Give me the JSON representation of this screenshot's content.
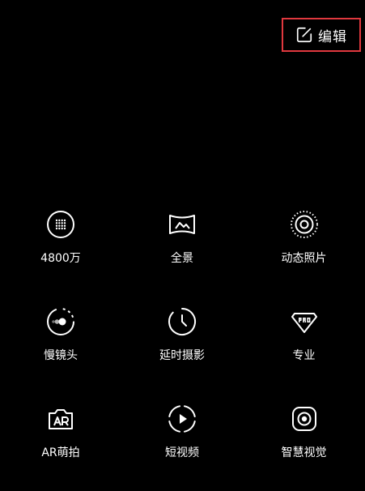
{
  "header": {
    "edit_label": "编辑",
    "edit_icon": "edit-icon",
    "highlight_color": "#e0383e"
  },
  "modes": [
    {
      "label": "4800万",
      "icon": "grid-dots-icon"
    },
    {
      "label": "全景",
      "icon": "panorama-icon"
    },
    {
      "label": "动态照片",
      "icon": "live-photo-icon"
    },
    {
      "label": "慢镜头",
      "icon": "slow-motion-icon"
    },
    {
      "label": "延时摄影",
      "icon": "timelapse-icon"
    },
    {
      "label": "专业",
      "icon": "pro-badge-icon"
    },
    {
      "label": "AR萌拍",
      "icon": "ar-camera-icon"
    },
    {
      "label": "短视频",
      "icon": "short-video-icon"
    },
    {
      "label": "智慧视觉",
      "icon": "smart-vision-icon"
    }
  ]
}
